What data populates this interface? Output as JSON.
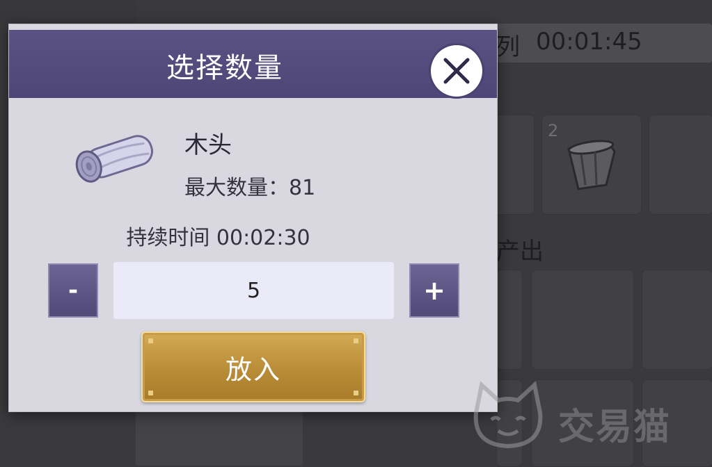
{
  "background": {
    "queue_label_fragment": "列",
    "queue_timer": "00:01:45",
    "slot_badge": "2",
    "output_label_fragment": "产出"
  },
  "dialog": {
    "title": "选择数量",
    "item": {
      "name": "木头",
      "max_label": "最大数量：",
      "max_value": "81"
    },
    "duration_label": "持续时间",
    "duration_value": "00:02:30",
    "quantity": "5",
    "minus_label": "-",
    "plus_label": "+",
    "confirm_label": "放入"
  },
  "watermark": {
    "text": "交易猫"
  },
  "icons": {
    "close": "close-icon",
    "item": "log-icon",
    "watermark_logo": "cat-icon"
  }
}
